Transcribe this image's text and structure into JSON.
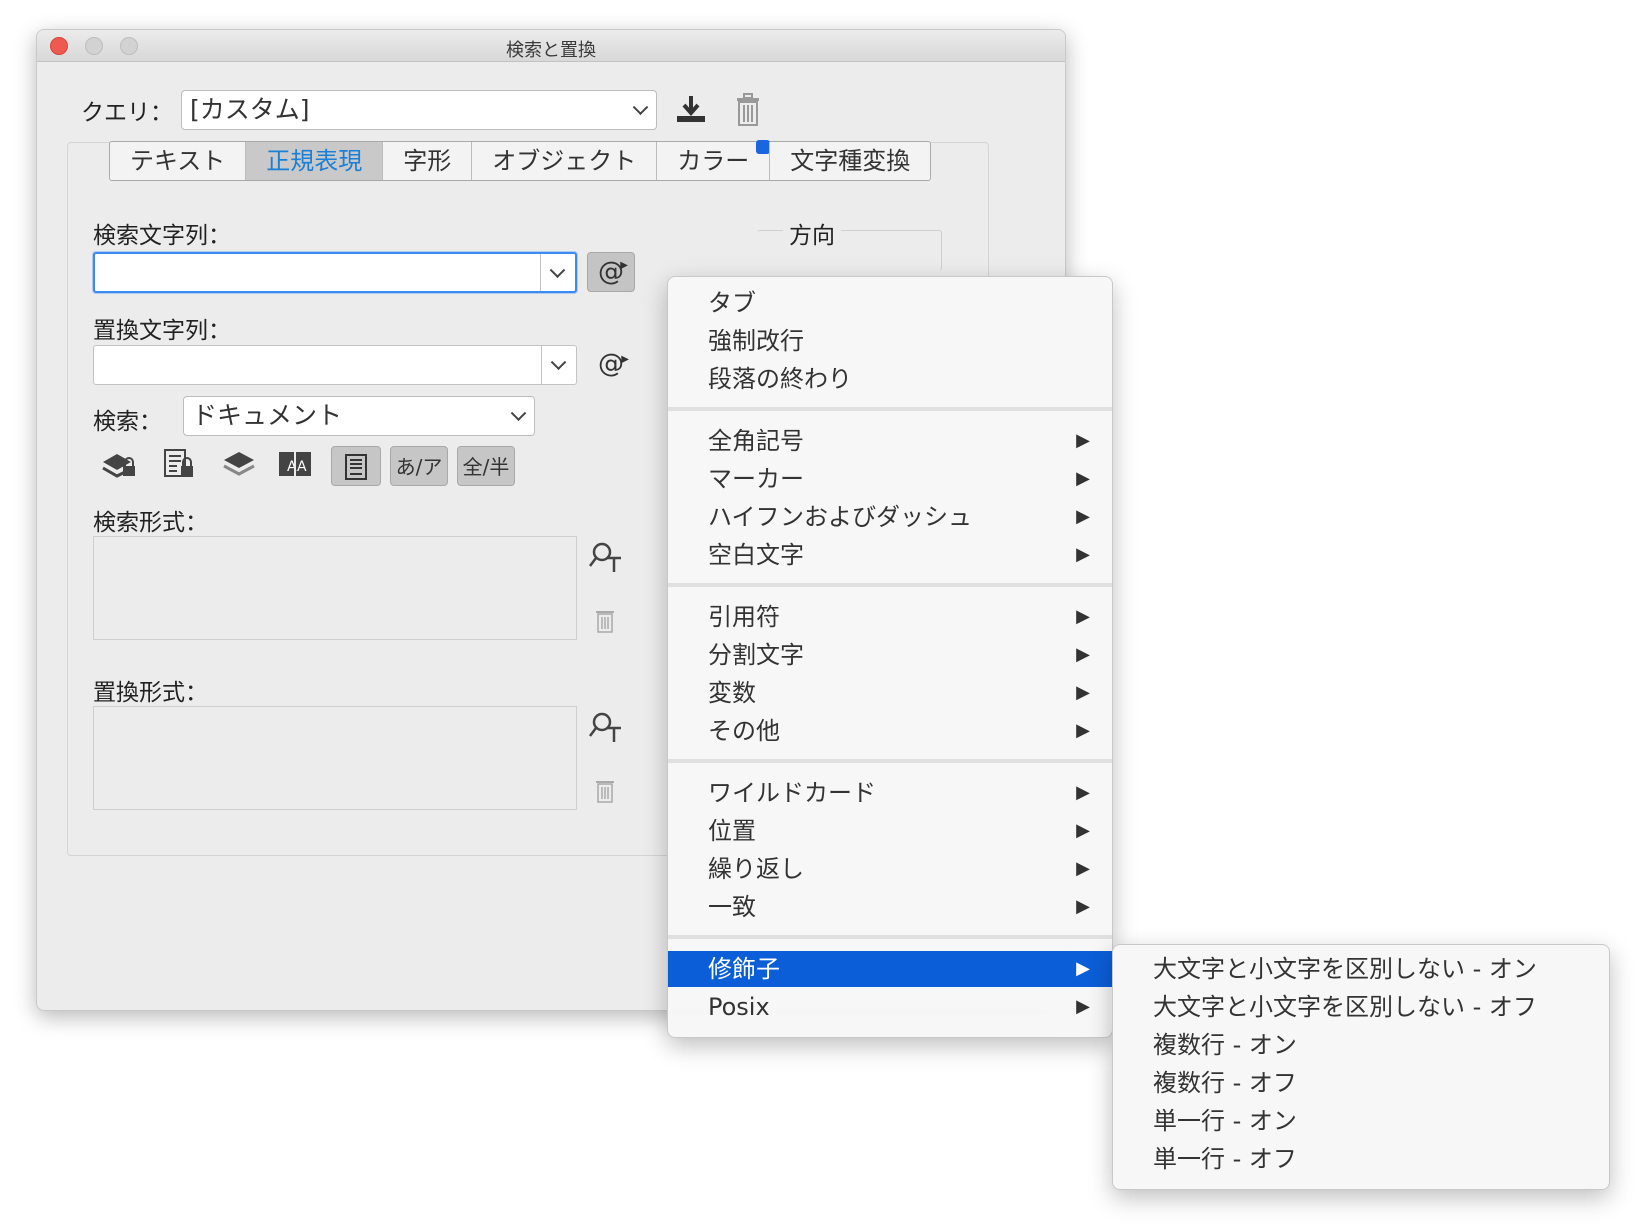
{
  "window": {
    "title": "検索と置換"
  },
  "query": {
    "label": "クエリ：",
    "value": "[カスタム]"
  },
  "tabs": [
    {
      "label": "テキスト",
      "active": false
    },
    {
      "label": "正規表現",
      "active": true
    },
    {
      "label": "字形",
      "active": false
    },
    {
      "label": "オブジェクト",
      "active": false
    },
    {
      "label": "カラー",
      "active": false
    },
    {
      "label": "文字種変換",
      "active": false
    }
  ],
  "search": {
    "find_label": "検索文字列：",
    "find_value": "",
    "replace_label": "置換文字列：",
    "replace_value": "",
    "special_char_glyph": "@",
    "scope_label": "検索：",
    "scope_value": "ドキュメント",
    "direction_label": "方向"
  },
  "options": {
    "kana_toggle": "あ/ア",
    "width_toggle": "全/半"
  },
  "formats": {
    "find_label": "検索形式：",
    "replace_label": "置換形式："
  },
  "menu": {
    "groups": [
      [
        "タブ",
        "強制改行",
        "段落の終わり"
      ],
      [
        "全角記号",
        "マーカー",
        "ハイフンおよびダッシュ",
        "空白文字"
      ],
      [
        "引用符",
        "分割文字",
        "変数",
        "その他"
      ],
      [
        "ワイルドカード",
        "位置",
        "繰り返し",
        "一致"
      ],
      [
        "修飾子",
        "Posix"
      ]
    ],
    "arrow": "▶"
  },
  "submenu": {
    "items": [
      "大文字と小文字を区別しない - オン",
      "大文字と小文字を区別しない - オフ",
      "複数行 - オン",
      "複数行 - オフ",
      "単一行 - オン",
      "単一行 - オフ"
    ]
  },
  "colors": {
    "accent": "#1a7fd6",
    "menu_highlight": "#0b5ed7",
    "close": "#ee5a52"
  }
}
